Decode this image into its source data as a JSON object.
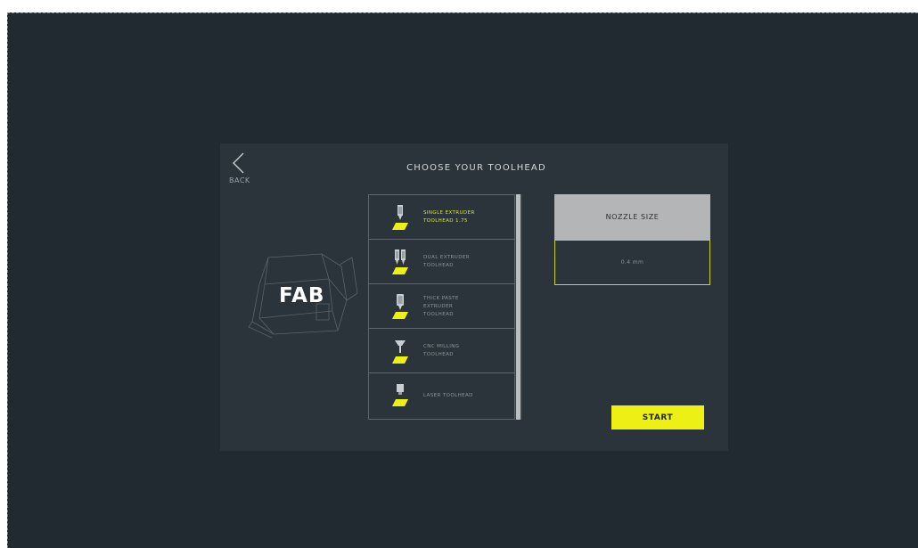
{
  "header": {
    "back_label": "BACK",
    "title": "CHOOSE YOUR TOOLHEAD"
  },
  "machine": {
    "label": "FAB"
  },
  "toolheads": [
    {
      "lines": [
        "SINGLE EXTRUDER",
        "TOOLHEAD 1.75"
      ],
      "icon": "single-extruder-icon",
      "selected": true
    },
    {
      "lines": [
        "DUAL EXTRUDER",
        "TOOLHEAD"
      ],
      "icon": "dual-extruder-icon",
      "selected": false
    },
    {
      "lines": [
        "THICK PASTE",
        "EXTRUDER",
        "TOOLHEAD"
      ],
      "icon": "paste-extruder-icon",
      "selected": false
    },
    {
      "lines": [
        "CNC MILLING",
        "TOOLHEAD"
      ],
      "icon": "cnc-milling-icon",
      "selected": false
    },
    {
      "lines": [
        "LASER TOOLHEAD"
      ],
      "icon": "laser-icon",
      "selected": false
    }
  ],
  "nozzle": {
    "header": "NOZZLE SIZE",
    "value": "0.4 mm"
  },
  "actions": {
    "start_label": "START"
  },
  "colors": {
    "background": "#212931",
    "panel": "#2b343a",
    "accent": "#ecf013",
    "selected_text": "#d7e24a",
    "nozzle_header": "#b3b5b7"
  }
}
